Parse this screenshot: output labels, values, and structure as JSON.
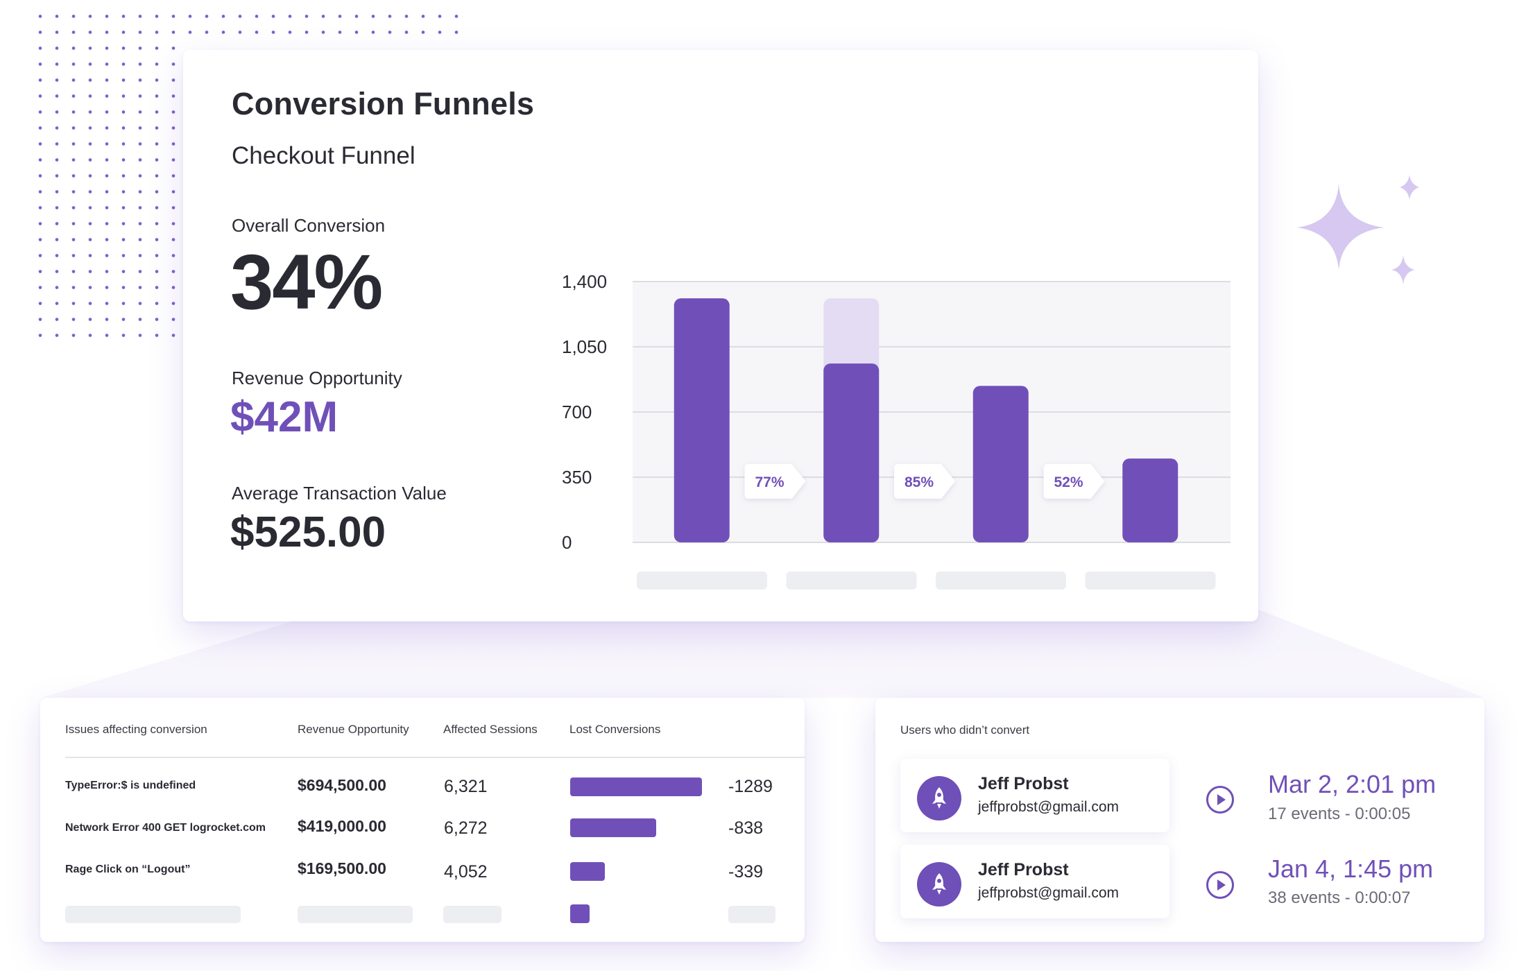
{
  "colors": {
    "accent": "#7050b8",
    "accent_light": "#e4dcf2",
    "text": "#2a2a33",
    "grid": "#dcdce3"
  },
  "main": {
    "title": "Conversion Funnels",
    "subtitle": "Checkout Funnel",
    "overall_label": "Overall Conversion",
    "overall_value": "34%",
    "revenue_label": "Revenue Opportunity",
    "revenue_value": "$42M",
    "atv_label": "Average Transaction Value",
    "atv_value": "$525.00"
  },
  "chart_data": {
    "type": "bar",
    "categories": [
      "",
      "",
      "",
      ""
    ],
    "values": [
      1310,
      960,
      840,
      450
    ],
    "ghost_values": [
      null,
      1310,
      null,
      null
    ],
    "step_rates": [
      "77%",
      "85%",
      "52%"
    ],
    "yticks": [
      "1,400",
      "1,050",
      "700",
      "350",
      "0"
    ],
    "ylim": [
      0,
      1400
    ],
    "grid": true
  },
  "issues": {
    "headers": [
      "Issues affecting conversion",
      "Revenue Opportunity",
      "Affected Sessions",
      "Lost Conversions"
    ],
    "rows": [
      {
        "issue": "TypeError:$ is undefined",
        "revenue": "$694,500.00",
        "sessions": "6,321",
        "lost": "-1289",
        "lost_value": 1289
      },
      {
        "issue": "Network Error 400 GET logrocket.com",
        "revenue": "$419,000.00",
        "sessions": "6,272",
        "lost": "-838",
        "lost_value": 838
      },
      {
        "issue": "Rage Click on “Logout”",
        "revenue": "$169,500.00",
        "sessions": "4,052",
        "lost": "-339",
        "lost_value": 339
      }
    ]
  },
  "users": {
    "header": "Users who didn’t convert",
    "items": [
      {
        "name": "Jeff Probst",
        "email": "jeffprobst@gmail.com",
        "date": "Mar 2, 2:01 pm",
        "events": "17 events - 0:00:05",
        "icon": "rocket-icon"
      },
      {
        "name": "Jeff Probst",
        "email": "jeffprobst@gmail.com",
        "date": "Jan 4, 1:45 pm",
        "events": "38 events - 0:00:07",
        "icon": "rocket-icon"
      }
    ]
  }
}
